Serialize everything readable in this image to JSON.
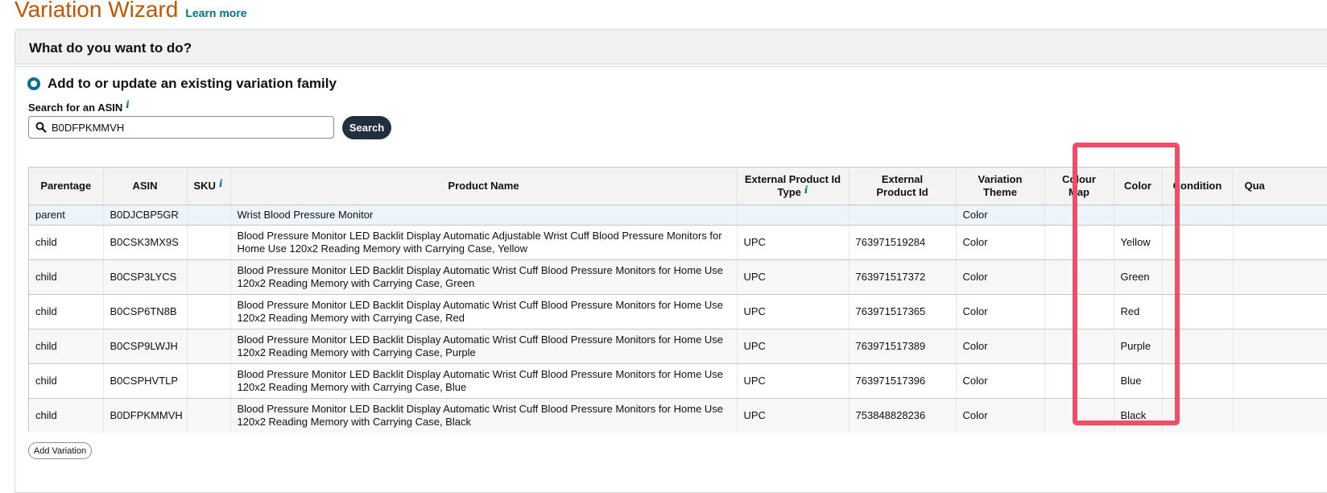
{
  "header": {
    "title": "Variation Wizard",
    "learn_more": "Learn more"
  },
  "question": "What do you want to do?",
  "option": {
    "label": "Add to or update an existing variation family",
    "selected": true
  },
  "search": {
    "label": "Search for an ASIN",
    "value": "B0DFPKMMVH",
    "button": "Search"
  },
  "table": {
    "columns": {
      "parentage": "Parentage",
      "asin": "ASIN",
      "sku": "SKU",
      "product_name": "Product Name",
      "ext_type": "External Product Id Type",
      "ext_id": "External Product Id",
      "variation_theme": "Variation Theme",
      "colour_map": "Colour Map",
      "color": "Color",
      "condition": "Condition",
      "quantity": "Qua"
    },
    "rows": [
      {
        "parentage": "parent",
        "asin": "B0DJCBP5GR",
        "sku": "",
        "product_name": "Wrist Blood Pressure Monitor",
        "ext_type": "",
        "ext_id": "",
        "variation_theme": "Color",
        "colour_map": "",
        "color": "",
        "condition": "",
        "quantity": ""
      },
      {
        "parentage": "child",
        "asin": "B0CSK3MX9S",
        "sku": "",
        "product_name": "Blood Pressure Monitor LED Backlit Display Automatic Adjustable Wrist Cuff Blood Pressure Monitors for Home Use 120x2 Reading Memory with Carrying Case, Yellow",
        "ext_type": "UPC",
        "ext_id": "763971519284",
        "variation_theme": "Color",
        "colour_map": "",
        "color": "Yellow",
        "condition": "",
        "quantity": ""
      },
      {
        "parentage": "child",
        "asin": "B0CSP3LYCS",
        "sku": "",
        "product_name": "Blood Pressure Monitor LED Backlit Display Automatic Wrist Cuff Blood Pressure Monitors for Home Use 120x2 Reading Memory with Carrying Case, Green",
        "ext_type": "UPC",
        "ext_id": "763971517372",
        "variation_theme": "Color",
        "colour_map": "",
        "color": "Green",
        "condition": "",
        "quantity": ""
      },
      {
        "parentage": "child",
        "asin": "B0CSP6TN8B",
        "sku": "",
        "product_name": "Blood Pressure Monitor LED Backlit Display Automatic Wrist Cuff Blood Pressure Monitors for Home Use 120x2 Reading Memory with Carrying Case, Red",
        "ext_type": "UPC",
        "ext_id": "763971517365",
        "variation_theme": "Color",
        "colour_map": "",
        "color": "Red",
        "condition": "",
        "quantity": ""
      },
      {
        "parentage": "child",
        "asin": "B0CSP9LWJH",
        "sku": "",
        "product_name": "Blood Pressure Monitor LED Backlit Display Automatic Wrist Cuff Blood Pressure Monitors for Home Use 120x2 Reading Memory with Carrying Case, Purple",
        "ext_type": "UPC",
        "ext_id": "763971517389",
        "variation_theme": "Color",
        "colour_map": "",
        "color": "Purple",
        "condition": "",
        "quantity": ""
      },
      {
        "parentage": "child",
        "asin": "B0CSPHVTLP",
        "sku": "",
        "product_name": "Blood Pressure Monitor LED Backlit Display Automatic Wrist Cuff Blood Pressure Monitors for Home Use 120x2 Reading Memory with Carrying Case, Blue",
        "ext_type": "UPC",
        "ext_id": "763971517396",
        "variation_theme": "Color",
        "colour_map": "",
        "color": "Blue",
        "condition": "",
        "quantity": ""
      },
      {
        "parentage": "child",
        "asin": "B0DFPKMMVH",
        "sku": "",
        "product_name": "Blood Pressure Monitor LED Backlit Display Automatic Wrist Cuff Blood Pressure Monitors for Home Use 120x2 Reading Memory with Carrying Case, Black",
        "ext_type": "UPC",
        "ext_id": "753848828236",
        "variation_theme": "Color",
        "colour_map": "",
        "color": "Black",
        "condition": "",
        "quantity": ""
      }
    ]
  },
  "add_variation": "Add Variation",
  "colors": {
    "title": "#c45500",
    "link": "#007185",
    "button_dark": "#232f3e",
    "highlight": "#f24d68"
  }
}
